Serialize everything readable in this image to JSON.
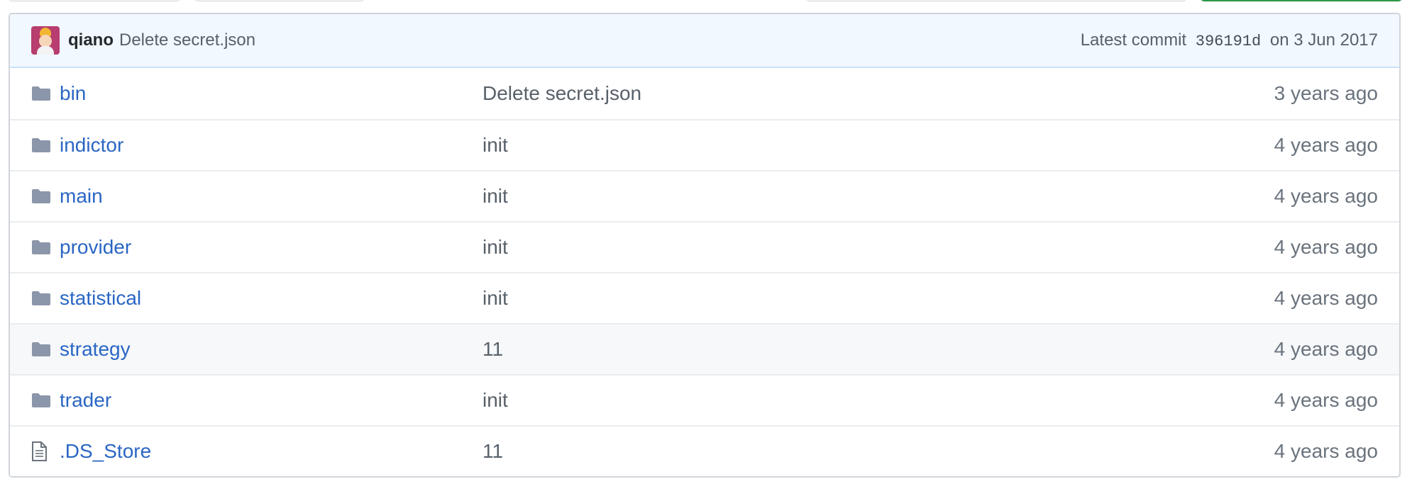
{
  "commit": {
    "author": "qiano",
    "message": "Delete secret.json",
    "latest_label": "Latest commit",
    "sha": "396191d",
    "date": "on 3 Jun 2017"
  },
  "files": [
    {
      "type": "dir",
      "icon": "folder-icon",
      "name": "bin",
      "message": "Delete secret.json",
      "age": "3 years ago"
    },
    {
      "type": "dir",
      "icon": "folder-icon",
      "name": "indictor",
      "message": "init",
      "age": "4 years ago"
    },
    {
      "type": "dir",
      "icon": "folder-icon",
      "name": "main",
      "message": "init",
      "age": "4 years ago"
    },
    {
      "type": "dir",
      "icon": "folder-icon",
      "name": "provider",
      "message": "init",
      "age": "4 years ago"
    },
    {
      "type": "dir",
      "icon": "folder-icon",
      "name": "statistical",
      "message": "init",
      "age": "4 years ago"
    },
    {
      "type": "dir",
      "icon": "folder-icon",
      "name": "strategy",
      "message": "11",
      "age": "4 years ago"
    },
    {
      "type": "dir",
      "icon": "folder-icon",
      "name": "trader",
      "message": "init",
      "age": "4 years ago"
    },
    {
      "type": "file",
      "icon": "file-icon",
      "name": ".DS_Store",
      "message": "11",
      "age": "4 years ago"
    }
  ],
  "colors": {
    "link": "#2a66c4",
    "folder": "#8c96aa",
    "commit_bar_bg": "#f1f8ff",
    "hover_row_bg": "#f6f8fa"
  }
}
